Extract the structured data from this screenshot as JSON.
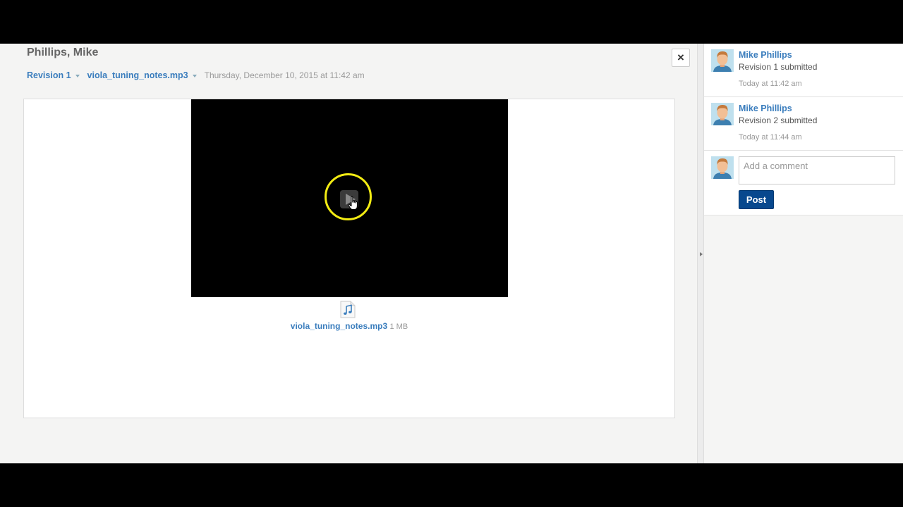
{
  "header": {
    "student_name": "Phillips, Mike",
    "revision_label": "Revision 1",
    "file_label": "viola_tuning_notes.mp3",
    "timestamp": "Thursday, December 10, 2015 at 11:42 am",
    "close_label": "×"
  },
  "preview": {
    "file_name": "viola_tuning_notes.mp3",
    "file_size": "1 MB",
    "icons": {
      "play": "play-icon",
      "file": "audio-file-icon",
      "cursor": "hand-cursor-icon"
    }
  },
  "sidebar": {
    "comments": [
      {
        "author": "Mike Phillips",
        "text": "Revision 1 submitted",
        "time": "Today at 11:42 am"
      },
      {
        "author": "Mike Phillips",
        "text": "Revision 2 submitted",
        "time": "Today at 11:44 am"
      }
    ],
    "compose": {
      "placeholder": "Add a comment",
      "post_label": "Post"
    }
  },
  "colors": {
    "link": "#3a7dbd",
    "post_button": "#08488e",
    "highlight": "#f3ec13"
  }
}
